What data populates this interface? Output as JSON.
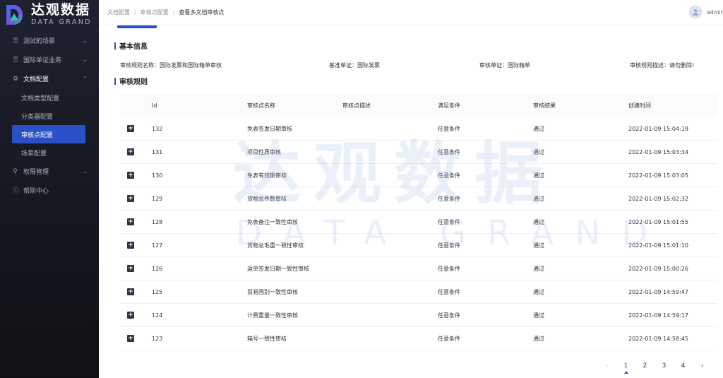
{
  "brand": {
    "name_cn": "达观数据",
    "name_en": "DATA GRAND",
    "accent_color": "#2a4fc6"
  },
  "sidebar": {
    "items": [
      {
        "label": "测试的场景",
        "icon": "list-icon",
        "expanded": false
      },
      {
        "label": "国际单证业务",
        "icon": "list-icon",
        "expanded": false
      },
      {
        "label": "文档配置",
        "icon": "gear-icon",
        "expanded": true,
        "children": [
          {
            "label": "文档类型配置"
          },
          {
            "label": "分类器配置"
          },
          {
            "label": "审核点配置",
            "active": true
          },
          {
            "label": "场景配置"
          }
        ]
      },
      {
        "label": "权限管理",
        "icon": "key-icon",
        "expanded": false
      },
      {
        "label": "帮助中心",
        "icon": "info-icon",
        "expanded": false
      }
    ]
  },
  "header": {
    "breadcrumb": [
      "文档配置",
      "审核点配置",
      "查看多文档审核点"
    ],
    "user_name": "admir"
  },
  "basic_info": {
    "title": "基本信息",
    "rule_name": "审核规则名称：国际发票和国际箱单审核",
    "base_doc": "基准单证：国际发票",
    "audit_doc": "审核单证：国际箱单",
    "rule_desc": "审核规则描述：请勿删除!"
  },
  "rules": {
    "title": "审核规则",
    "columns": [
      "Id",
      "审核点名称",
      "审核点描述",
      "满足条件",
      "审核结果",
      "创建时间"
    ],
    "rows": [
      {
        "id": "132",
        "name": "免表签发日期审核",
        "desc": "",
        "cond": "任意条件",
        "result": "通过",
        "time": "2022-01-09 15:04:19"
      },
      {
        "id": "131",
        "name": "项目性质审核",
        "desc": "",
        "cond": "任意条件",
        "result": "通过",
        "time": "2022-01-09 15:03:34"
      },
      {
        "id": "130",
        "name": "免表有效期审核",
        "desc": "",
        "cond": "任意条件",
        "result": "通过",
        "time": "2022-01-09 15:03:05"
      },
      {
        "id": "129",
        "name": "货物总件数审核",
        "desc": "",
        "cond": "任意条件",
        "result": "通过",
        "time": "2022-01-09 15:02:32"
      },
      {
        "id": "128",
        "name": "免表备注一致性审核",
        "desc": "",
        "cond": "任意条件",
        "result": "通过",
        "time": "2022-01-09 15:01:55"
      },
      {
        "id": "127",
        "name": "货物总毛重一致性审核",
        "desc": "",
        "cond": "任意条件",
        "result": "通过",
        "time": "2022-01-09 15:01:10"
      },
      {
        "id": "126",
        "name": "运单签发日期一致性审核",
        "desc": "",
        "cond": "任意条件",
        "result": "通过",
        "time": "2022-01-09 15:00:26"
      },
      {
        "id": "125",
        "name": "贸易国别一致性审核",
        "desc": "",
        "cond": "任意条件",
        "result": "通过",
        "time": "2022-01-09 14:59:47"
      },
      {
        "id": "124",
        "name": "计费重量一致性审核",
        "desc": "",
        "cond": "任意条件",
        "result": "通过",
        "time": "2022-01-09 14:59:17"
      },
      {
        "id": "123",
        "name": "箱号一致性审核",
        "desc": "",
        "cond": "任意条件",
        "result": "通过",
        "time": "2022-01-09 14:58:45"
      }
    ]
  },
  "pagination": {
    "pages": [
      "1",
      "2",
      "3",
      "4"
    ],
    "current": "1",
    "prev": "‹",
    "next": "›"
  },
  "watermark": {
    "cn": "达观数据",
    "en": "DATA GRAND"
  }
}
